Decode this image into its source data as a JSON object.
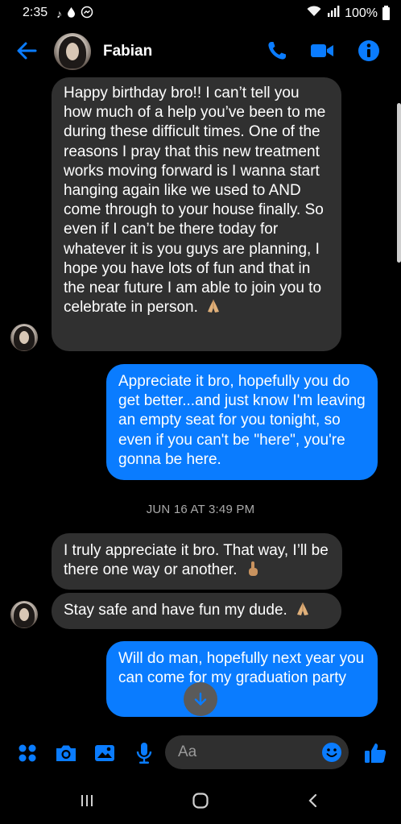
{
  "status_bar": {
    "time": "2:35",
    "battery": "100%"
  },
  "header": {
    "contact_name": "Fabian",
    "icons": [
      "back-arrow-icon",
      "phone-icon",
      "video-camera-icon",
      "info-icon"
    ]
  },
  "messages": [
    {
      "direction": "incoming",
      "text": "Happy birthday bro!! I can’t tell you how much of a help you’ve been to me during these difficult times. One of the reasons I pray that this new treatment works moving forward is I wanna start hanging again like we used to AND come through to your house finally. So even if I can’t be there today for whatever it is you guys are planning, I hope you have lots of fun and that in the near future I am able to join you to celebrate in person.",
      "emoji": "folded-hands-emoji"
    },
    {
      "direction": "outgoing",
      "text": "Appreciate it bro, hopefully you do get better...and just know I'm leaving an empty seat for you tonight, so even if you can't be \"here\", you're gonna be here."
    },
    {
      "direction": "incoming",
      "text": "I truly appreciate it bro. That way, I’ll be there one way or another.",
      "emoji": "index-pointing-up-emoji"
    },
    {
      "direction": "incoming",
      "text": "Stay safe and have fun my dude.",
      "emoji": "folded-hands-emoji"
    },
    {
      "direction": "outgoing",
      "text": "Will do man, hopefully next year you can come for my graduation party"
    }
  ],
  "timestamp": "JUN 16 AT 3:49 PM",
  "composer": {
    "placeholder": "Aa",
    "value": ""
  },
  "colors": {
    "accent": "#0a7cff",
    "incoming_bubble": "#303030",
    "background": "#000000"
  }
}
